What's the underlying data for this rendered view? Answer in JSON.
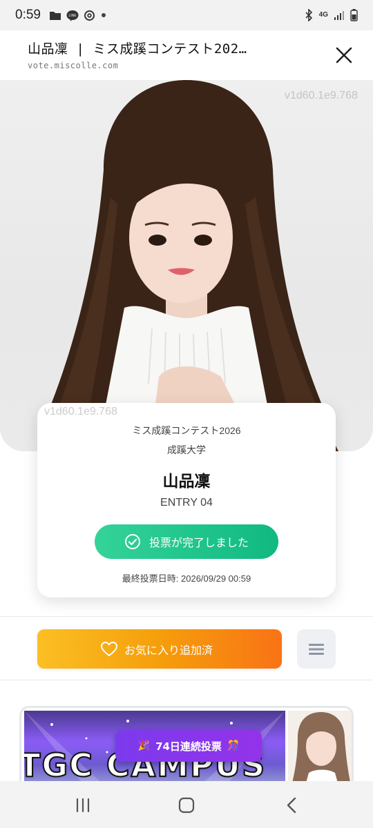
{
  "status_bar": {
    "time": "0:59",
    "network": "4G",
    "icons_left": [
      "folder-icon",
      "line-app-icon",
      "threads-icon",
      "dot-icon"
    ],
    "icons_right": [
      "bluetooth-icon",
      "network-arrows-icon",
      "signal-icon",
      "battery-icon"
    ]
  },
  "browser": {
    "title": "山品凜 | ミス成蹊コンテスト202…",
    "domain": "vote.miscolle.com"
  },
  "hero": {
    "watermark": "v1d60.1e9.768"
  },
  "entry": {
    "contest": "ミス成蹊コンテスト2026",
    "university": "成蹊大学",
    "name": "山品凜",
    "entry_no": "ENTRY 04",
    "vote_label": "投票が完了しました",
    "last_vote": "最終投票日時: 2026/09/29 00:59",
    "watermark": "v1d60.1e9.768"
  },
  "actions": {
    "favorite_label": "お気に入り追加済"
  },
  "banner": {
    "text": "TGC CAMPUS",
    "streak": "74日連続投票"
  },
  "colors": {
    "vote_green": "#10b981",
    "favorite_orange": "#f59e0b",
    "streak_purple": "#7c3aed"
  }
}
